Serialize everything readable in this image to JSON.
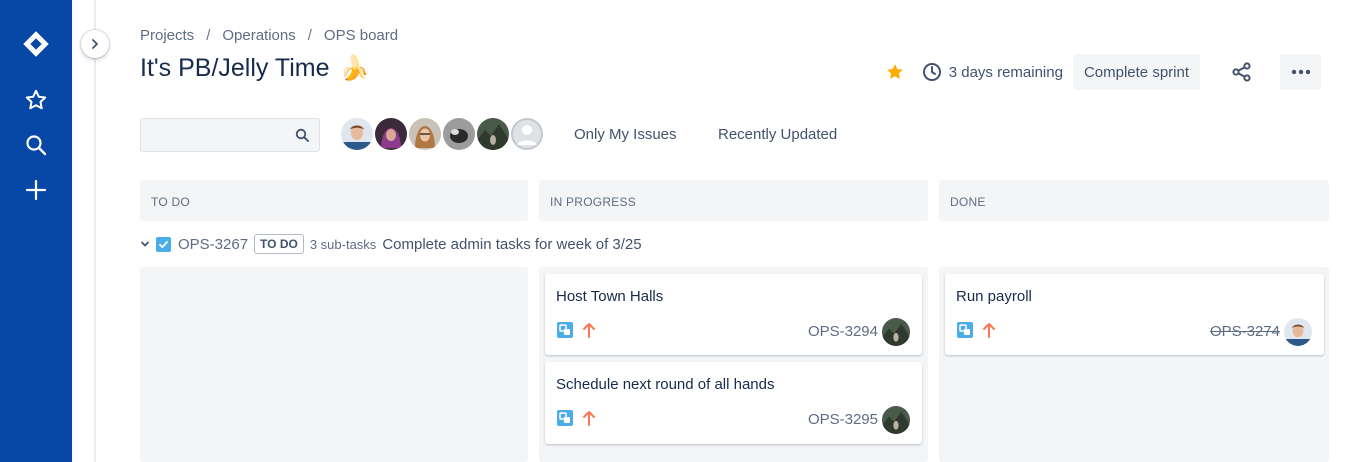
{
  "nav": {
    "icons": [
      "jira-logo-icon",
      "star-icon",
      "search-icon",
      "plus-icon"
    ]
  },
  "breadcrumbs": [
    "Projects",
    "Operations",
    "OPS board"
  ],
  "breadcrumb_separator": "/",
  "title": "It's PB/Jelly Time",
  "title_emoji": "🍌",
  "header": {
    "days_remaining": "3 days remaining",
    "complete_sprint": "Complete sprint"
  },
  "filters": {
    "search_placeholder": "",
    "only_my_issues": "Only My Issues",
    "recently_updated": "Recently Updated"
  },
  "columns": [
    "TO DO",
    "IN PROGRESS",
    "DONE"
  ],
  "swimlane": {
    "key": "OPS-3267",
    "status": "TO DO",
    "subtasks": "3 sub-tasks",
    "summary": "Complete admin tasks for week of 3/25"
  },
  "cards": [
    {
      "summary": "Host Town Halls",
      "key": "OPS-3294",
      "column": "IN PROGRESS"
    },
    {
      "summary": "Schedule next round of all hands",
      "key": "OPS-3295",
      "column": "IN PROGRESS"
    },
    {
      "summary": "Run payroll",
      "key": "OPS-3274",
      "column": "DONE"
    }
  ],
  "colors": {
    "nav_bg": "#0747a6",
    "star": "#ffab00",
    "subtask_icon": "#4bade8",
    "priority_high": "#ff7452",
    "column_bg": "#f4f5f7"
  }
}
